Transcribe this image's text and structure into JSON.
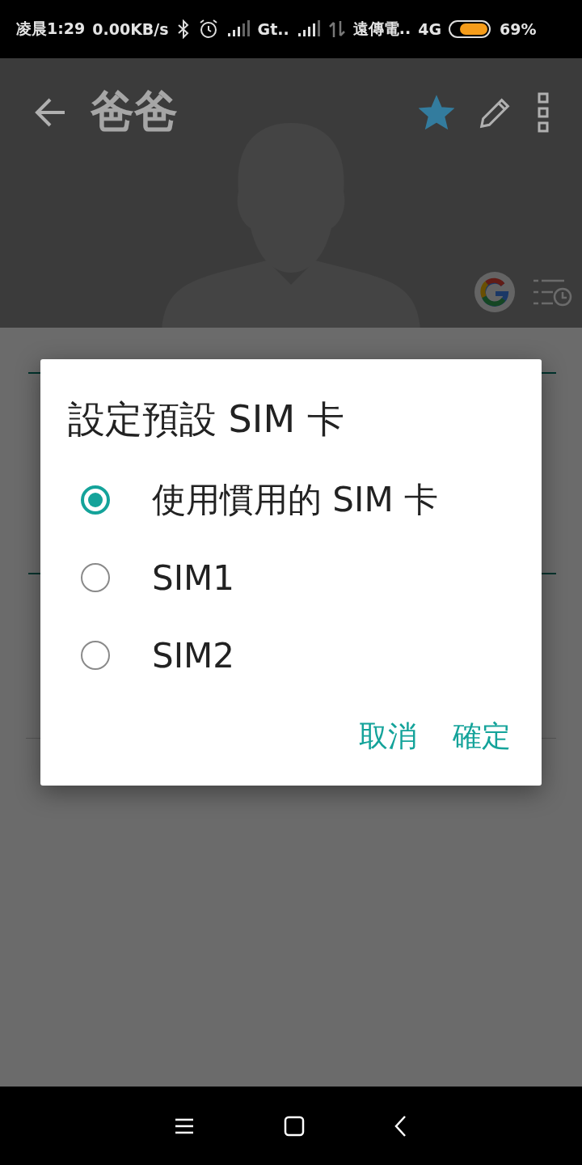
{
  "status_bar": {
    "time": "凌晨1:29",
    "speed": "0.00KB/s",
    "carrier_1": "Gt..",
    "carrier_2": "遠傳電..",
    "network": "4G",
    "battery": "69%"
  },
  "header": {
    "title": "爸爸",
    "favorite": true
  },
  "dialog": {
    "title": "設定預設 SIM 卡",
    "options": [
      {
        "label": "使用慣用的 SIM 卡",
        "selected": true
      },
      {
        "label": "SIM1",
        "selected": false
      },
      {
        "label": "SIM2",
        "selected": false
      }
    ],
    "buttons": [
      "取消",
      "確定"
    ]
  }
}
